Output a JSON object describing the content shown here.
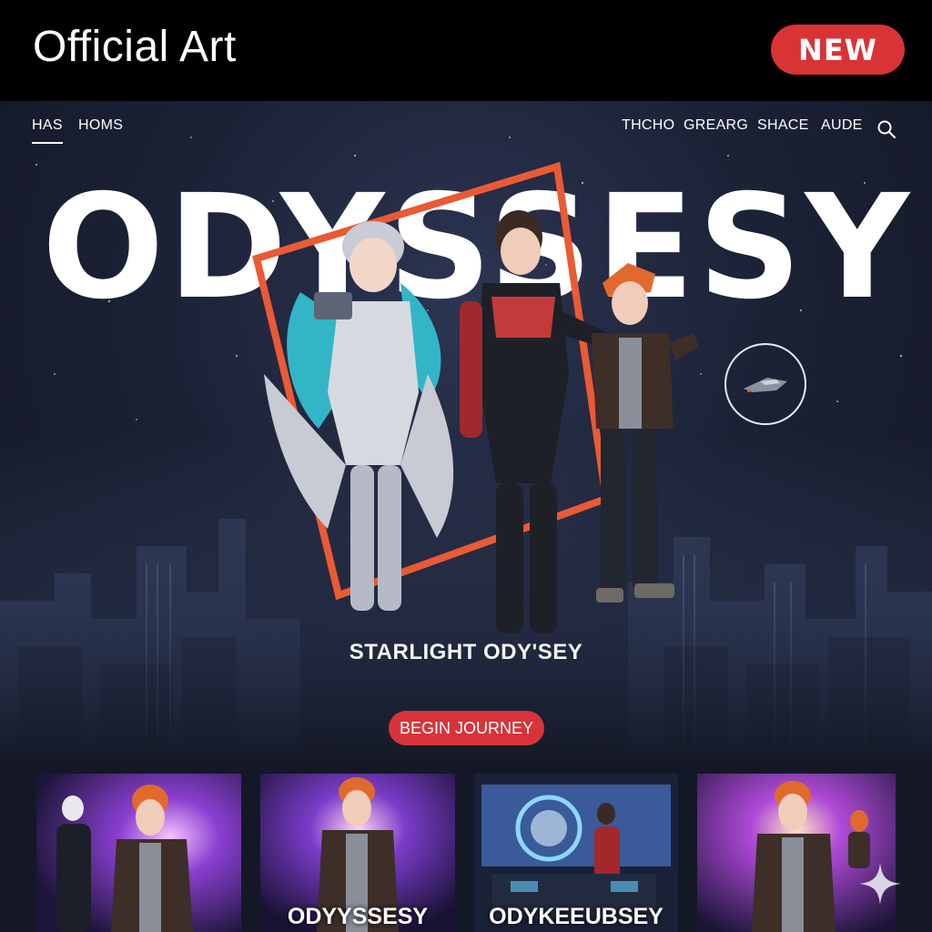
{
  "banner": {
    "title": "Official Art",
    "badge": "NEW"
  },
  "nav": {
    "left": [
      "HAS",
      "HOMS"
    ],
    "right": [
      "THCHO",
      "GREARG",
      "SHACE",
      "AUDE"
    ]
  },
  "hero": {
    "title": "ODYSSESY",
    "subtitle": "STARLIGHT ODY'SEY",
    "cta": "BEGIN JOURNEY"
  },
  "thumbnails": [
    {
      "caption": ""
    },
    {
      "caption": "ODYYSSESY"
    },
    {
      "caption": "ODYKEEUBSEY"
    },
    {
      "caption": ""
    }
  ],
  "colors": {
    "accent": "#d6343a",
    "frame": "#ea5a34",
    "background": "#141826"
  },
  "icons": [
    "search-icon",
    "ship-icon",
    "sparkle-icon"
  ]
}
